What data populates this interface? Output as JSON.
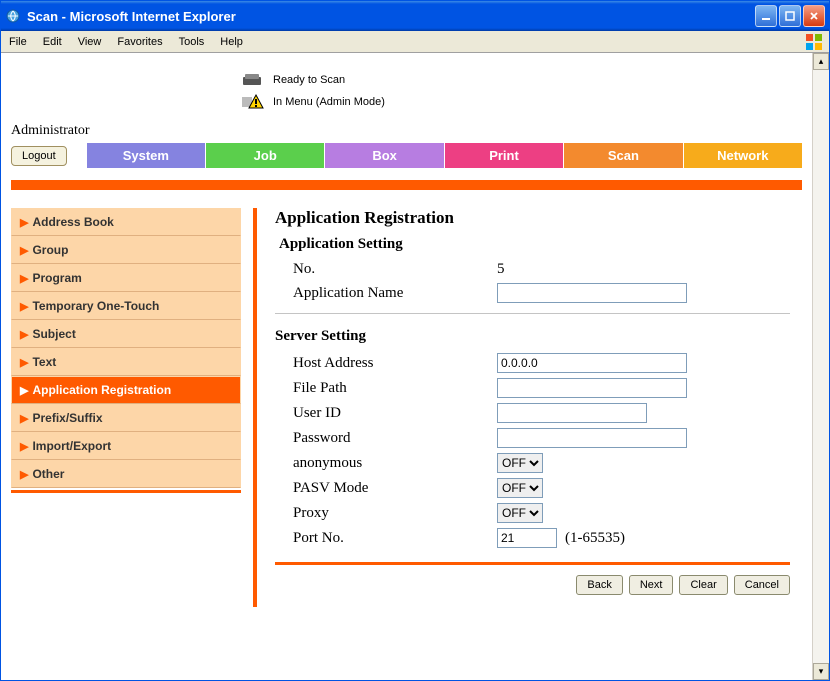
{
  "window": {
    "title": "Scan - Microsoft Internet Explorer"
  },
  "menu": {
    "file": "File",
    "edit": "Edit",
    "view": "View",
    "favorites": "Favorites",
    "tools": "Tools",
    "help": "Help"
  },
  "status": {
    "ready": "Ready to Scan",
    "menu": "In Menu (Admin Mode)"
  },
  "admin": {
    "label": "Administrator",
    "logout": "Logout"
  },
  "tabs": {
    "system": "System",
    "job": "Job",
    "box": "Box",
    "print": "Print",
    "scan": "Scan",
    "network": "Network"
  },
  "sidebar": {
    "items": [
      {
        "label": "Address Book"
      },
      {
        "label": "Group"
      },
      {
        "label": "Program"
      },
      {
        "label": "Temporary One-Touch"
      },
      {
        "label": "Subject"
      },
      {
        "label": "Text"
      },
      {
        "label": "Application Registration"
      },
      {
        "label": "Prefix/Suffix"
      },
      {
        "label": "Import/Export"
      },
      {
        "label": "Other"
      }
    ]
  },
  "page": {
    "title": "Application Registration",
    "app_setting_title": "Application Setting",
    "no_label": "No.",
    "no_value": "5",
    "app_name_label": "Application Name",
    "app_name_value": "",
    "server_setting_title": "Server Setting",
    "host_label": "Host Address",
    "host_value": "0.0.0.0",
    "filepath_label": "File Path",
    "filepath_value": "",
    "userid_label": "User ID",
    "userid_value": "",
    "password_label": "Password",
    "password_value": "",
    "anonymous_label": "anonymous",
    "anonymous_value": "OFF",
    "pasv_label": "PASV Mode",
    "pasv_value": "OFF",
    "proxy_label": "Proxy",
    "proxy_value": "OFF",
    "port_label": "Port No.",
    "port_value": "21",
    "port_range": "(1-65535)",
    "buttons": {
      "back": "Back",
      "next": "Next",
      "clear": "Clear",
      "cancel": "Cancel"
    }
  }
}
